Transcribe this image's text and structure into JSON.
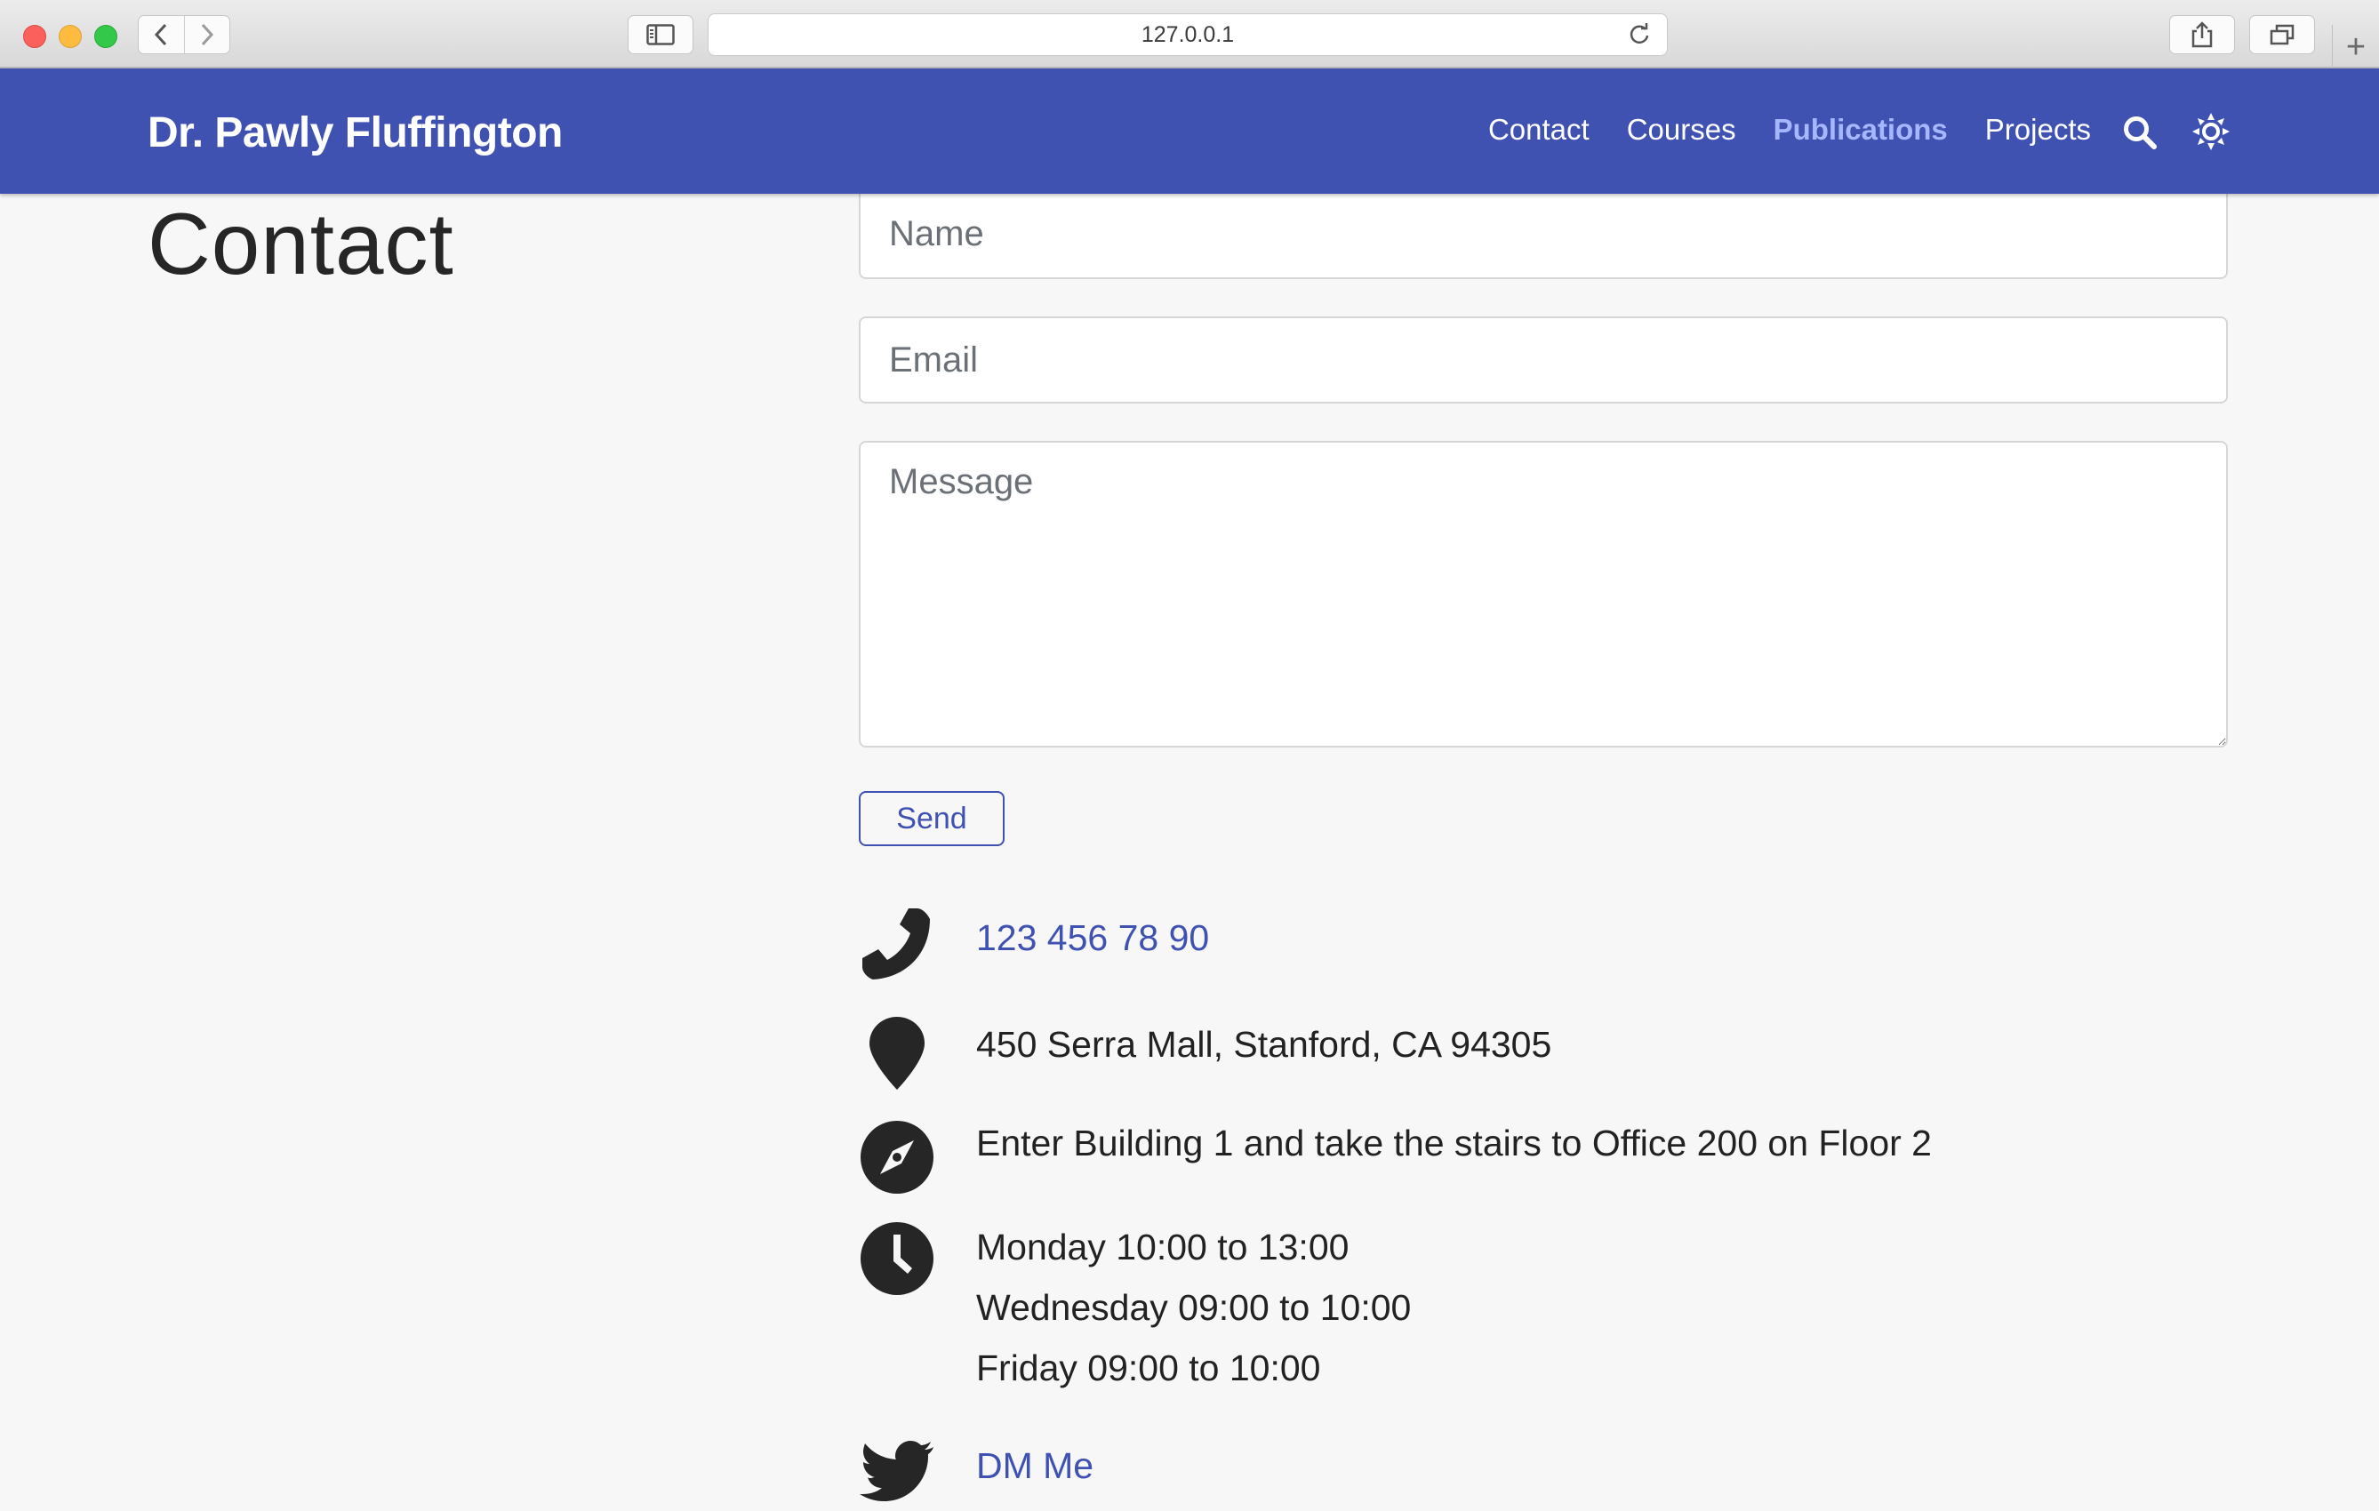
{
  "browser": {
    "url": "127.0.0.1",
    "new_tab_label": "+"
  },
  "site": {
    "brand": "Dr. Pawly Fluffington",
    "nav": [
      {
        "label": "Contact",
        "active": false
      },
      {
        "label": "Courses",
        "active": false
      },
      {
        "label": "Publications",
        "active": true
      },
      {
        "label": "Projects",
        "active": false
      }
    ],
    "icons": {
      "search": "search-icon",
      "theme": "sun-icon"
    },
    "colors": {
      "navbar": "#3f51b1",
      "accent": "#3f51b1",
      "active_link": "#a6b7ff",
      "background": "#f7f7f7"
    }
  },
  "contact": {
    "title": "Contact",
    "form": {
      "name_placeholder": "Name",
      "email_placeholder": "Email",
      "message_placeholder": "Message",
      "send_label": "Send"
    },
    "phone": "123 456 78 90",
    "address": "450 Serra Mall, Stanford, CA 94305",
    "directions": "Enter Building 1 and take the stairs to Office 200 on Floor 2",
    "hours": [
      "Monday 10:00 to 13:00",
      "Wednesday 09:00 to 10:00",
      "Friday 09:00 to 10:00"
    ],
    "twitter": "DM Me"
  }
}
